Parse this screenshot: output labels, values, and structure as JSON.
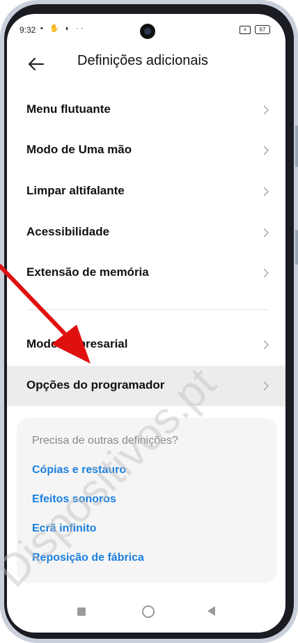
{
  "status": {
    "time": "9:32",
    "icons": "▪ ✋ ◐ ··",
    "battery": "67"
  },
  "header": {
    "title": "Definições adicionais"
  },
  "settings": {
    "items": [
      {
        "label": "Menu flutuante"
      },
      {
        "label": "Modo de Uma mão"
      },
      {
        "label": "Limpar altifalante"
      },
      {
        "label": "Acessibilidade"
      },
      {
        "label": "Extensão de memória"
      },
      {
        "label": "Modo empresarial"
      },
      {
        "label": "Opções do programador"
      }
    ]
  },
  "suggestions": {
    "hint": "Precisa de outras definições?",
    "links": [
      {
        "label": "Cópias e restauro"
      },
      {
        "label": "Efeitos sonoros"
      },
      {
        "label": "Ecrã infinito"
      },
      {
        "label": "Reposição de fábrica"
      }
    ]
  },
  "watermark": "Dispositivos.pt",
  "colors": {
    "link": "#1a7fe0",
    "arrow": "#e01010",
    "highlight": "#ececec"
  }
}
